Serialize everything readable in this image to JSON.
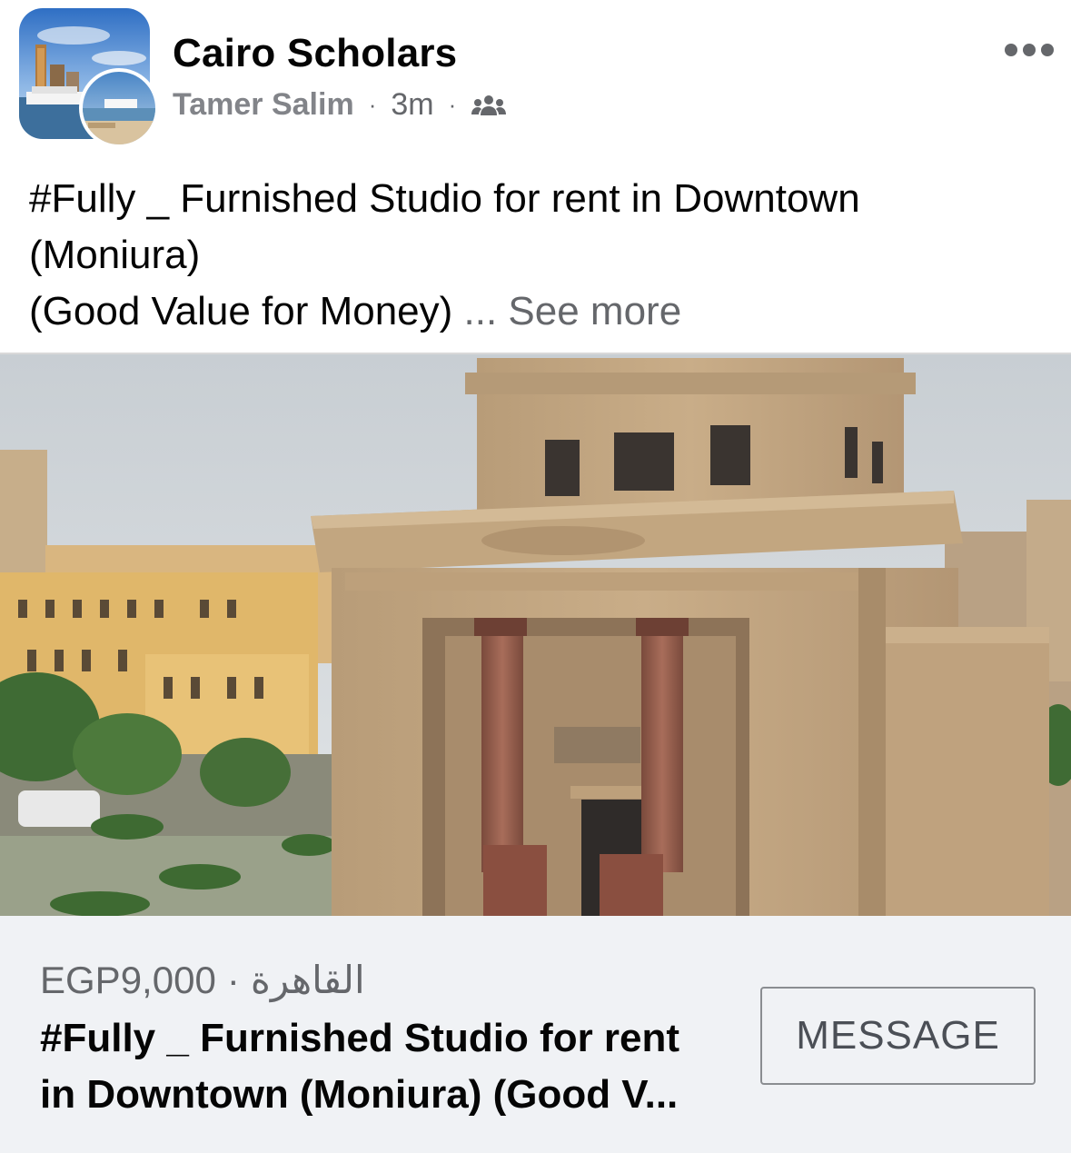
{
  "header": {
    "group_name": "Cairo Scholars",
    "author": "Tamer Salim",
    "separator": "·",
    "time": "3m",
    "audience_icon": "group-members-icon",
    "more_icon": "more-options-icon"
  },
  "post": {
    "line1": "#Fully _ Furnished Studio for rent in Downtown",
    "line2": "(Moniura)",
    "line3": "(Good Value for Money)",
    "see_more": " ... See more"
  },
  "listing": {
    "price": "EGP9,000",
    "separator": "·",
    "location": "القاهرة",
    "title_line1": "#Fully _ Furnished Studio for rent",
    "title_line2": "in Downtown (Moniura) (Good V...",
    "message_label": "MESSAGE"
  },
  "colors": {
    "primary_text": "#050505",
    "secondary_text": "#65676b",
    "card_background": "#f0f2f5",
    "button_border": "#8a8d91"
  }
}
